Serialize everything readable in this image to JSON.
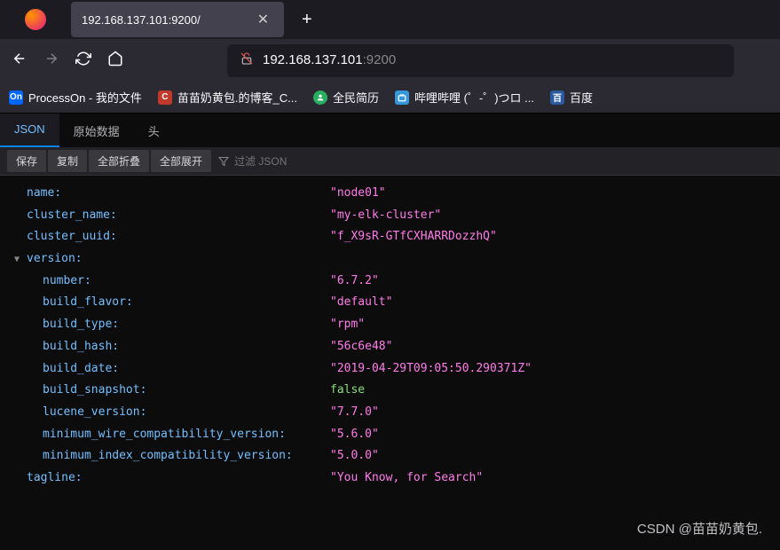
{
  "browser": {
    "tab_title": "192.168.137.101:9200/",
    "url_host": "192.168.137.101",
    "url_port": ":9200"
  },
  "bookmarks": [
    {
      "icon": "bm-blue",
      "icon_text": "On",
      "label": "ProcessOn - 我的文件"
    },
    {
      "icon": "bm-red",
      "icon_text": "C",
      "label": "苗苗奶黄包.的博客_C..."
    },
    {
      "icon": "bm-green",
      "icon_text": "",
      "label": "全民简历"
    },
    {
      "icon": "bm-lightblue",
      "icon_text": "",
      "label": "哔哩哔哩 (゜-゜)つロ ..."
    },
    {
      "icon": "bm-bluewhite",
      "icon_text": "百",
      "label": "百度"
    }
  ],
  "json_viewer": {
    "tabs": {
      "json": "JSON",
      "raw": "原始数据",
      "headers": "头"
    },
    "toolbar": {
      "save": "保存",
      "copy": "复制",
      "collapse": "全部折叠",
      "expand": "全部展开",
      "filter_placeholder": "过滤 JSON"
    }
  },
  "json_data": {
    "name": {
      "key": "name:",
      "value": "\"node01\""
    },
    "cluster_name": {
      "key": "cluster_name:",
      "value": "\"my-elk-cluster\""
    },
    "cluster_uuid": {
      "key": "cluster_uuid:",
      "value": "\"f_X9sR-GTfCXHARRDozzhQ\""
    },
    "version": {
      "key": "version:"
    },
    "number": {
      "key": "number:",
      "value": "\"6.7.2\""
    },
    "build_flavor": {
      "key": "build_flavor:",
      "value": "\"default\""
    },
    "build_type": {
      "key": "build_type:",
      "value": "\"rpm\""
    },
    "build_hash": {
      "key": "build_hash:",
      "value": "\"56c6e48\""
    },
    "build_date": {
      "key": "build_date:",
      "value": "\"2019-04-29T09:05:50.290371Z\""
    },
    "build_snapshot": {
      "key": "build_snapshot:",
      "value": "false"
    },
    "lucene_version": {
      "key": "lucene_version:",
      "value": "\"7.7.0\""
    },
    "minimum_wire_compatibility_version": {
      "key": "minimum_wire_compatibility_version:",
      "value": "\"5.6.0\""
    },
    "minimum_index_compatibility_version": {
      "key": "minimum_index_compatibility_version:",
      "value": "\"5.0.0\""
    },
    "tagline": {
      "key": "tagline:",
      "value": "\"You Know, for Search\""
    }
  },
  "watermark": "CSDN @苗苗奶黄包."
}
